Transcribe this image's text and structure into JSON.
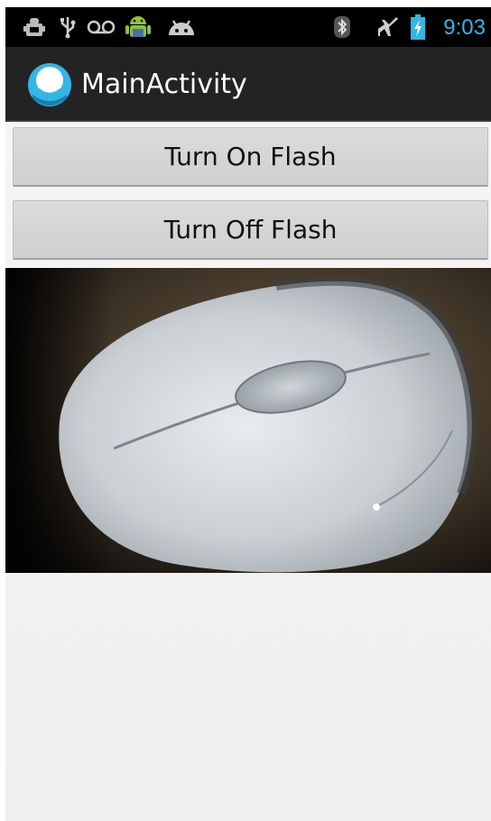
{
  "status_bar": {
    "time": "9:03",
    "icons": [
      "debug-icon",
      "usb-icon",
      "voicemail-icon",
      "android-notification-icon",
      "android-head-icon",
      "bluetooth-icon",
      "airplane-mode-icon",
      "battery-charging-icon"
    ]
  },
  "action_bar": {
    "title": "MainActivity",
    "icon": "app-launcher-icon"
  },
  "buttons": {
    "turn_on": "Turn On Flash",
    "turn_off": "Turn Off Flash"
  },
  "camera_preview": {
    "subject": "mouse-photo"
  },
  "colors": {
    "status_bar_bg": "#000000",
    "action_bar_bg": "#232323",
    "accent": "#33b5e5",
    "button_bg": "#d6d6d6"
  }
}
